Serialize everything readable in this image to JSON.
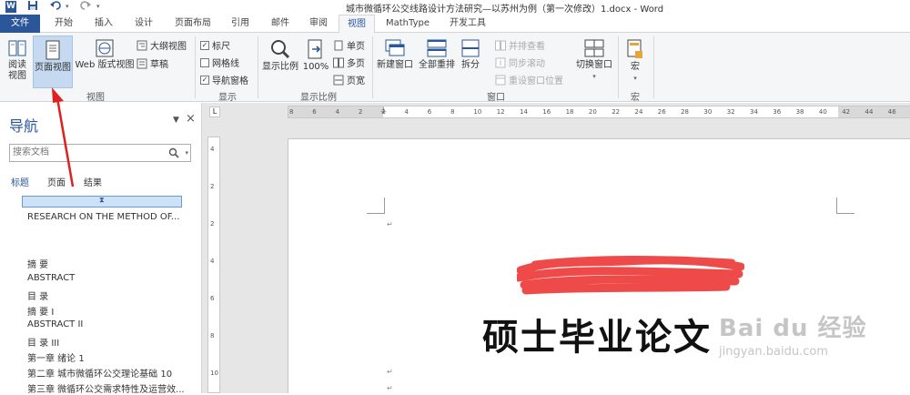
{
  "window": {
    "title": "城市微循环公交线路设计方法研究—以苏州为例（第一次修改）1.docx - Word"
  },
  "quick_access": [
    "W",
    "save",
    "undo",
    "redo"
  ],
  "tabs": [
    {
      "label": "文件",
      "state": "file"
    },
    {
      "label": "开始"
    },
    {
      "label": "插入"
    },
    {
      "label": "设计"
    },
    {
      "label": "页面布局"
    },
    {
      "label": "引用"
    },
    {
      "label": "邮件"
    },
    {
      "label": "审阅"
    },
    {
      "label": "视图",
      "state": "active"
    },
    {
      "label": "MathType"
    },
    {
      "label": "开发工具"
    }
  ],
  "ribbon": {
    "groups": {
      "view": "视图",
      "show": "显示",
      "zoom": "显示比例",
      "window": "窗口",
      "macro": "宏"
    },
    "view_buttons": {
      "read_line1": "阅读",
      "read_line2": "视图",
      "page_view": "页面视图",
      "web_view": "Web 版式视图",
      "outline": "大纲视图",
      "draft": "草稿"
    },
    "show": {
      "ruler": "标尺",
      "gridlines": "网格线",
      "nav_pane": "导航窗格",
      "ruler_checked": "✓",
      "gridlines_checked": "",
      "nav_checked": "✓"
    },
    "zoom": {
      "zoom": "显示比例",
      "hundred": "100%",
      "one_page": "单页",
      "multi_page": "多页",
      "page_width": "页宽"
    },
    "window": {
      "new_window": "新建窗口",
      "arrange_all": "全部重排",
      "split": "拆分",
      "side_by_side": "并排查看",
      "sync_scroll": "同步滚动",
      "reset_pos": "重设窗口位置",
      "switch": "切换窗口"
    },
    "macro": {
      "label": "宏"
    }
  },
  "nav_pane": {
    "title": "导航",
    "search_placeholder": "搜索文档",
    "tabs": [
      "标题",
      "页面",
      "结果"
    ],
    "headings": [
      "RESEARCH ON THE METHOD OF...",
      "摘 要",
      "ABSTRACT",
      "目 录",
      "摘 要 I",
      "ABSTRACT II",
      "目 录 III",
      "第一章 绪论 1",
      "第二章 城市微循环公交理论基础 10",
      "第三章 微循环公交需求特性及运营效..."
    ]
  },
  "ruler": {
    "horizontal": [
      "8",
      "6",
      "4",
      "2",
      "2",
      "4",
      "6",
      "8",
      "10",
      "12",
      "14",
      "16",
      "18",
      "20",
      "22",
      "24",
      "26",
      "28",
      "30",
      "32",
      "34",
      "36",
      "38",
      "40",
      "42",
      "44",
      "46"
    ],
    "vertical": [
      "4",
      "2",
      "2",
      "4",
      "6",
      "8",
      "10"
    ],
    "corner": "L"
  },
  "document": {
    "title": "硕士毕业论文",
    "para_mark": "↵"
  },
  "watermark": {
    "brand": "Bai du 经验",
    "url": "jingyan.baidu.com"
  }
}
